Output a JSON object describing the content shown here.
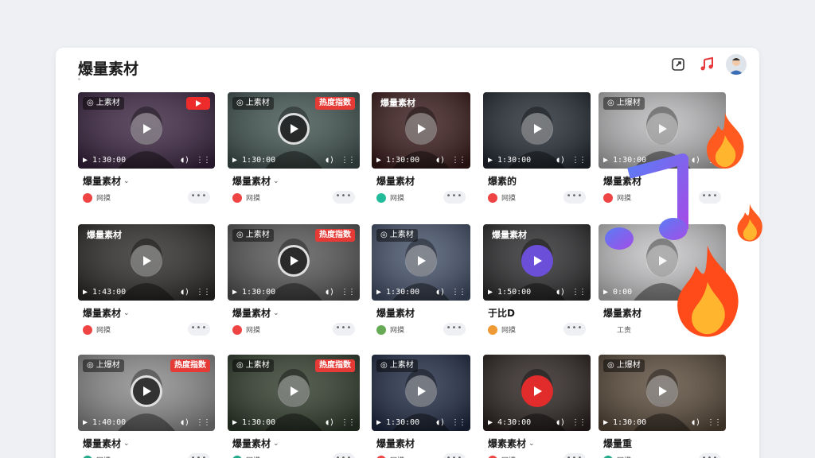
{
  "header": {
    "title": "爆量素材",
    "icons": [
      "share-icon",
      "music-note-icon",
      "avatar"
    ]
  },
  "colors": {
    "hot_tag": "#e53a35",
    "accent_purple": "#6b4fd8",
    "fire": "#ff5a1f"
  },
  "cards": [
    {
      "tag": "上素材",
      "tag_style": "chip",
      "badge": "youtube",
      "time": "1:30:00",
      "title": "爆量素材",
      "chevron": true,
      "author": "网摸",
      "author_color": "#e44",
      "play": "light",
      "scene": "#3a2340"
    },
    {
      "tag": "上素材",
      "tag_style": "chip",
      "badge": "热度指数",
      "time": "1:30:00",
      "title": "爆量素材",
      "chevron": true,
      "author": "网摸",
      "author_color": "#e44",
      "play": "dark",
      "scene": "#40534f"
    },
    {
      "tag": "爆量素材",
      "tag_style": "plain",
      "badge": "",
      "time": "1:30:00",
      "title": "爆量素材",
      "chevron": false,
      "author": "网摸",
      "author_color": "#2b9",
      "play": "light",
      "scene": "#3a1a1a"
    },
    {
      "tag": "",
      "tag_style": "none",
      "badge": "",
      "time": "1:30:00",
      "title": "爆素的",
      "chevron": false,
      "author": "网摸",
      "author_color": "#e44",
      "play": "light",
      "scene": "#232a33"
    },
    {
      "tag": "上爆材",
      "tag_style": "chip",
      "badge": "",
      "time": "1:30:00",
      "title": "爆量素材",
      "chevron": false,
      "author": "网摸",
      "author_color": "#e44",
      "play": "light-faded",
      "scene": "#b9b9bb"
    },
    {
      "tag": "爆量素材",
      "tag_style": "plain",
      "badge": "",
      "time": "1:43:00",
      "title": "爆量素材",
      "chevron": true,
      "author": "网摸",
      "author_color": "#e44",
      "play": "light",
      "scene": "#2c2a28"
    },
    {
      "tag": "上素材",
      "tag_style": "chip",
      "badge": "热度指数",
      "time": "1:30:00",
      "title": "爆量素材",
      "chevron": true,
      "author": "网摸",
      "author_color": "#e44",
      "play": "dark",
      "scene": "#555"
    },
    {
      "tag": "上素材",
      "tag_style": "chip",
      "badge": "",
      "time": "1:30:00",
      "title": "爆量素材",
      "chevron": false,
      "author": "网摸",
      "author_color": "#6a5",
      "play": "light",
      "scene": "#44516a"
    },
    {
      "tag": "爆量素材",
      "tag_style": "plain",
      "badge": "",
      "time": "1:50:00",
      "title": "于比D",
      "chevron": false,
      "author": "网摸",
      "author_color": "#e93",
      "play": "purple",
      "scene": "#2c2c2e"
    },
    {
      "tag": "",
      "tag_style": "none",
      "badge": "",
      "time": "0:00",
      "title": "爆量素材",
      "chevron": false,
      "author": "工责",
      "author_color": "#fff",
      "play": "light-faded",
      "scene": "#c4c4c6"
    },
    {
      "tag": "上爆材",
      "tag_style": "chip",
      "badge": "热度指数",
      "time": "1:40:00",
      "title": "爆量素材",
      "chevron": true,
      "author": "网摸",
      "author_color": "#2a8",
      "play": "dark",
      "scene": "#8a8a8a"
    },
    {
      "tag": "上素材",
      "tag_style": "chip",
      "badge": "热度指数",
      "time": "1:30:00",
      "title": "爆量素材",
      "chevron": true,
      "author": "网摸",
      "author_color": "#2a8",
      "play": "light",
      "scene": "#2f3a2a"
    },
    {
      "tag": "上素材",
      "tag_style": "chip",
      "badge": "",
      "time": "1:30:00",
      "title": "爆量素材",
      "chevron": false,
      "author": "网摸",
      "author_color": "#e44",
      "play": "light",
      "scene": "#1f2a44"
    },
    {
      "tag": "",
      "tag_style": "none",
      "badge": "",
      "time": "4:30:00",
      "title": "爆素素材",
      "chevron": true,
      "author": "网摸",
      "author_color": "#e44",
      "play": "red",
      "scene": "#2a2220"
    },
    {
      "tag": "上爆材",
      "tag_style": "chip",
      "badge": "",
      "time": "1:30:00",
      "title": "爆量重",
      "chevron": false,
      "author": "网摸",
      "author_color": "#2a8",
      "play": "light",
      "scene": "#5a4a3a"
    }
  ]
}
